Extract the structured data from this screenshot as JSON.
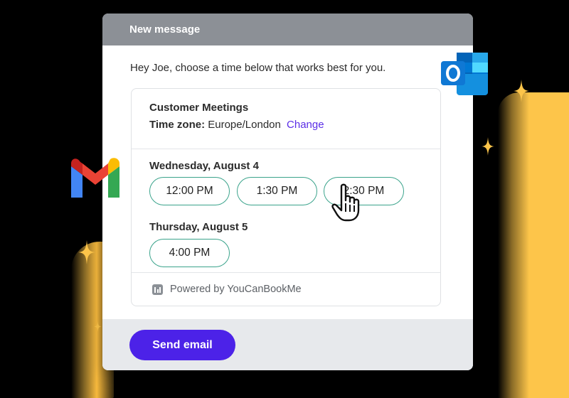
{
  "window": {
    "title": "New message"
  },
  "message": {
    "greeting": "Hey Joe, choose a time below that works best for you."
  },
  "booking": {
    "title": "Customer Meetings",
    "timezone_label": "Time zone:",
    "timezone_value": "Europe/London",
    "change_link": "Change",
    "days": [
      {
        "label": "Wednesday, August 4",
        "slots": [
          "12:00 PM",
          "1:30 PM",
          "2:30 PM"
        ]
      },
      {
        "label": "Thursday, August 5",
        "slots": [
          "4:00 PM"
        ]
      }
    ],
    "powered_by": "Powered by YouCanBookMe"
  },
  "footer": {
    "send_label": "Send email"
  },
  "icons": {
    "gmail": "gmail-icon",
    "outlook": "outlook-icon",
    "cursor": "hand-pointer-icon",
    "powered_logo": "youcanbookme-logo-icon",
    "sparkle": "sparkle-icon"
  },
  "colors": {
    "titlebar": "#8c9096",
    "slot_border": "#3aa38b",
    "link": "#5b2ee6",
    "send_button": "#4c22e8",
    "glow": "#fdc54a"
  }
}
